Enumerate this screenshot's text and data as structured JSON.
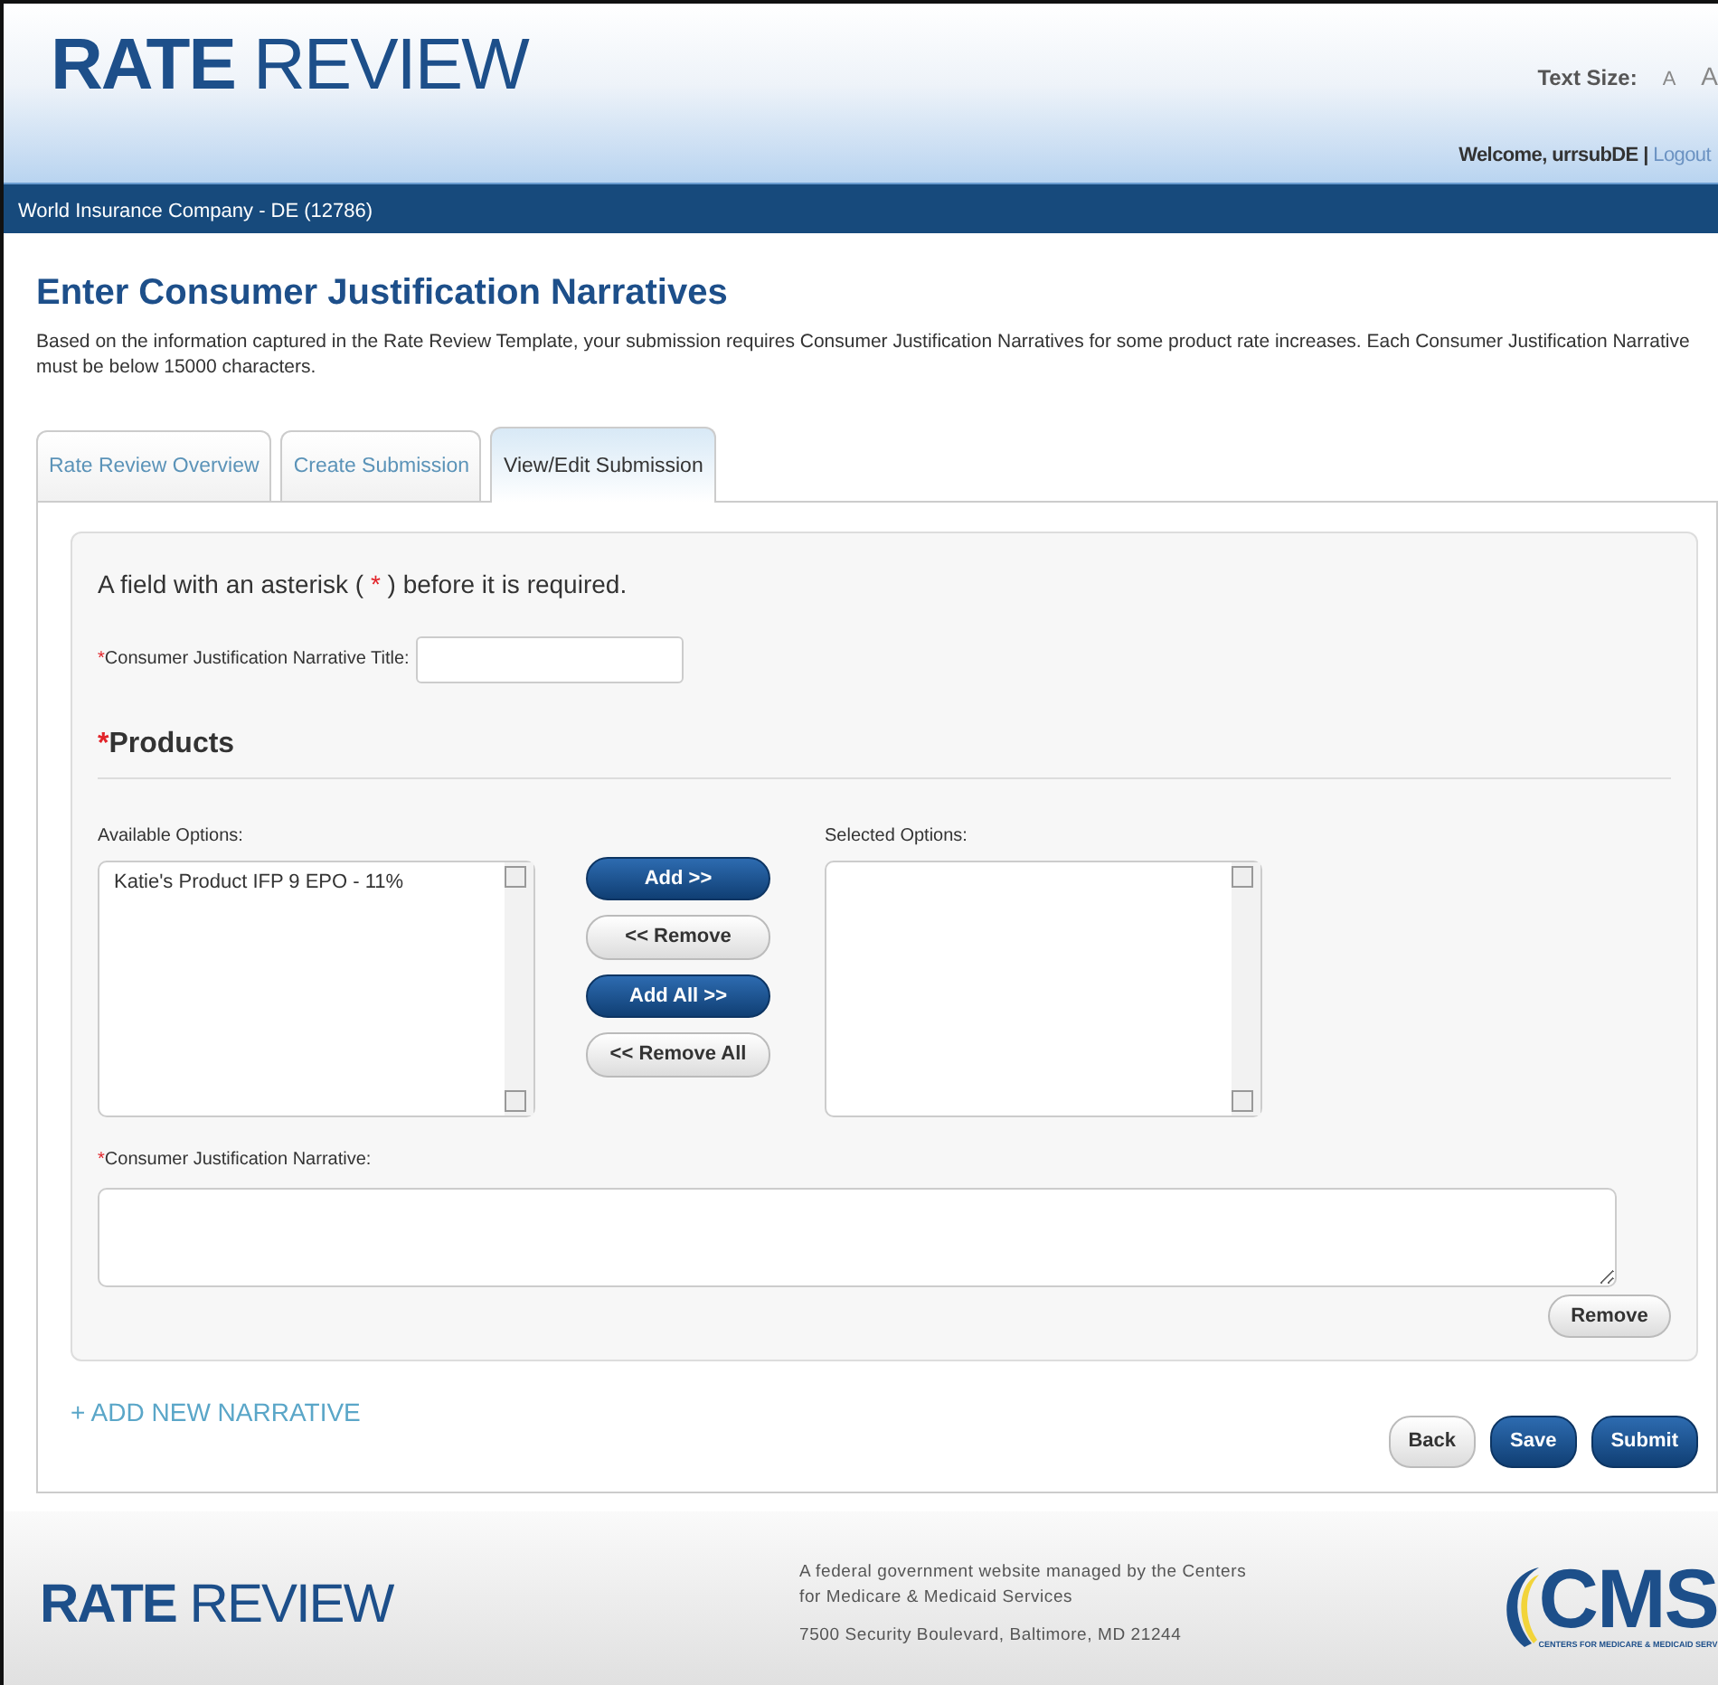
{
  "header": {
    "logo": {
      "bold": "RATE",
      "light": "REVIEW"
    },
    "text_size_label": "Text Size:",
    "text_size_options": [
      "A",
      "A"
    ],
    "welcome": "Welcome, urrsubDE",
    "separator": "|",
    "logout": "Logout"
  },
  "org_bar": "World Insurance Company - DE (12786)",
  "page_title": "Enter Consumer Justification Narratives",
  "description": "Based on the information captured in the Rate Review Template, your submission requires Consumer Justification Narratives for some product rate increases. Each Consumer Justification Narrative must be below 15000 characters.",
  "tabs": [
    {
      "label": "Rate Review Overview",
      "selected": false
    },
    {
      "label": "Create Submission",
      "selected": false
    },
    {
      "label": "View/Edit Submission",
      "selected": true
    }
  ],
  "required_note": {
    "before": "A field with an asterisk (",
    "mark": "*",
    "after": ") before it is required."
  },
  "title_field": {
    "mark": "*",
    "label": "Consumer Justification Narrative Title:"
  },
  "products": {
    "mark": "*",
    "heading": "Products",
    "available_label": "Available Options:",
    "available_items": [
      "Katie's Product IFP 9 EPO - 11%"
    ],
    "selected_label": "Selected Options:",
    "move_buttons": [
      {
        "label": "Add >>",
        "kind": "primary"
      },
      {
        "label": "<< Remove",
        "kind": "secondary"
      },
      {
        "label": "Add All >>",
        "kind": "primary"
      },
      {
        "label": "<< Remove All",
        "kind": "secondary"
      }
    ]
  },
  "narrative_field": {
    "mark": "*",
    "label": "Consumer Justification Narrative:"
  },
  "remove_button": "Remove",
  "add_new": "+ ADD NEW NARRATIVE",
  "actions": [
    {
      "label": "Back",
      "kind": "secondary"
    },
    {
      "label": "Save",
      "kind": "primary"
    },
    {
      "label": "Submit",
      "kind": "primary"
    }
  ],
  "footer": {
    "logo": {
      "bold": "RATE",
      "light": "REVIEW"
    },
    "lines": [
      "A federal government website managed by the Centers",
      "for Medicare & Medicaid Services"
    ],
    "address": "7500 Security Boulevard, Baltimore, MD 21244",
    "cms": {
      "name": "CMS",
      "subtitle": "CENTERS FOR MEDICARE & MEDICAID SERV"
    }
  }
}
